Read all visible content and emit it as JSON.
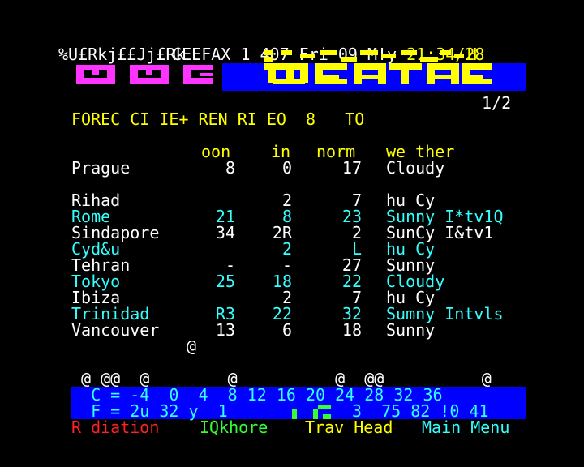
{
  "header": {
    "service": "CEEFAX",
    "page_no": "1",
    "page_id": "407",
    "day": "Fri",
    "date": "09",
    "month": "M!y",
    "time": "21:34/28"
  },
  "garbage_line": "%U£Rkj££Jj£Rk",
  "graphics_h": "H",
  "banner_stray": [
    "J",
    "I"
  ],
  "subpage": "1/2",
  "headline": "FOREC CI IE+ REN RI EO  8   TO",
  "columns": {
    "max": "oon",
    "min": "in",
    "norm": "norm",
    "weather": "we ther"
  },
  "rows": [
    {
      "city": "Prague",
      "max": "8",
      "min": "0",
      "norm": "17",
      "weather": "Cloudy",
      "color": "w"
    },
    {
      "city": "",
      "max": "",
      "min": "",
      "norm": "",
      "weather": "",
      "color": "w"
    },
    {
      "city": "Rihad",
      "max": "",
      "min": "2",
      "norm": "7",
      "weather": "hu Cy",
      "color": "w"
    },
    {
      "city": "Rome",
      "max": "21",
      "min": "8",
      "norm": "23",
      "weather": "Sunny I*tv1Q",
      "color": "c"
    },
    {
      "city": "Sindapore",
      "max": "34",
      "min": "2R",
      "norm": "2",
      "weather": "SunCy I&tv1",
      "color": "w"
    },
    {
      "city": "Cyd&u",
      "max": "",
      "min": "2",
      "norm": "L",
      "weather": "hu Cy",
      "color": "c"
    },
    {
      "city": "Tehran",
      "max": "-",
      "min": "-",
      "norm": "27",
      "weather": "Sunny",
      "color": "w"
    },
    {
      "city": "Tokyo",
      "max": "25",
      "min": "18",
      "norm": "22",
      "weather": "Cloudy",
      "color": "c"
    },
    {
      "city": "Ibiza",
      "max": "",
      "min": "2",
      "norm": "7",
      "weather": "hu Cy",
      "color": "w"
    },
    {
      "city": "Trinidad",
      "max": "R3",
      "min": "22",
      "norm": "32",
      "weather": "Sumny Intvls",
      "color": "c"
    },
    {
      "city": "Vancouver",
      "max": "13",
      "min": "6",
      "norm": "18",
      "weather": "Sunny",
      "color": "w"
    }
  ],
  "stray_at": "@",
  "at_line": " @ @@  @        @          @  @@          @",
  "scale": {
    "celsius_line": "  C = -4  0  4  8 12 16 20 24 28 32 36",
    "fahr_prefix": "  F = 2u 32 y  1",
    "fahr_suffix": "3  75 82 !0 41"
  },
  "fastext": [
    {
      "label": "R diation",
      "color": "#ff2222"
    },
    {
      "label": "IQkhore",
      "color": "#33ff33"
    },
    {
      "label": "Trav Head",
      "color": "#ffff00"
    },
    {
      "label": "Main Menu",
      "color": "#33ffff"
    }
  ]
}
